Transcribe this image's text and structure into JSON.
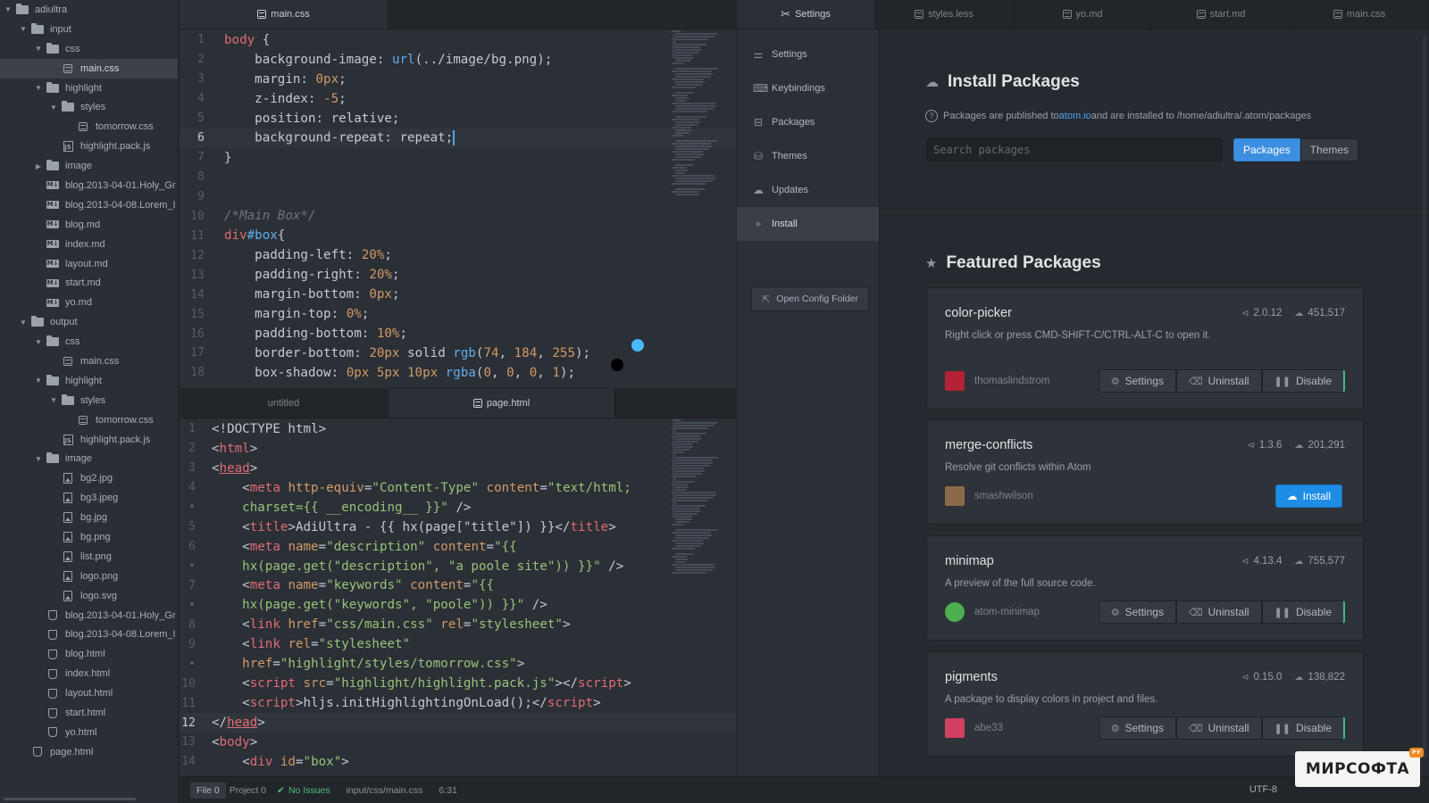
{
  "tree": [
    {
      "label": "adiultra",
      "icon": "folder",
      "depth": 0,
      "arrow": "down"
    },
    {
      "label": "input",
      "icon": "folder",
      "depth": 1,
      "arrow": "down"
    },
    {
      "label": "css",
      "icon": "folder",
      "depth": 2,
      "arrow": "down"
    },
    {
      "label": "main.css",
      "icon": "css",
      "depth": 3,
      "arrow": "none",
      "selected": true
    },
    {
      "label": "highlight",
      "icon": "folder",
      "depth": 2,
      "arrow": "down"
    },
    {
      "label": "styles",
      "icon": "folder",
      "depth": 3,
      "arrow": "down"
    },
    {
      "label": "tomorrow.css",
      "icon": "css",
      "depth": 4,
      "arrow": "none"
    },
    {
      "label": "highlight.pack.js",
      "icon": "js",
      "depth": 3,
      "arrow": "none"
    },
    {
      "label": "image",
      "icon": "folder",
      "depth": 2,
      "arrow": "right"
    },
    {
      "label": "blog.2013-04-01.Holy_Gr",
      "icon": "md",
      "depth": 2,
      "arrow": "none"
    },
    {
      "label": "blog.2013-04-08.Lorem_I",
      "icon": "md",
      "depth": 2,
      "arrow": "none"
    },
    {
      "label": "blog.md",
      "icon": "md",
      "depth": 2,
      "arrow": "none"
    },
    {
      "label": "index.md",
      "icon": "md",
      "depth": 2,
      "arrow": "none"
    },
    {
      "label": "layout.md",
      "icon": "md",
      "depth": 2,
      "arrow": "none"
    },
    {
      "label": "start.md",
      "icon": "md",
      "depth": 2,
      "arrow": "none"
    },
    {
      "label": "yo.md",
      "icon": "md",
      "depth": 2,
      "arrow": "none"
    },
    {
      "label": "output",
      "icon": "folder",
      "depth": 1,
      "arrow": "down"
    },
    {
      "label": "css",
      "icon": "folder",
      "depth": 2,
      "arrow": "down"
    },
    {
      "label": "main.css",
      "icon": "css",
      "depth": 3,
      "arrow": "none"
    },
    {
      "label": "highlight",
      "icon": "folder",
      "depth": 2,
      "arrow": "down"
    },
    {
      "label": "styles",
      "icon": "folder",
      "depth": 3,
      "arrow": "down"
    },
    {
      "label": "tomorrow.css",
      "icon": "css",
      "depth": 4,
      "arrow": "none"
    },
    {
      "label": "highlight.pack.js",
      "icon": "js",
      "depth": 3,
      "arrow": "none"
    },
    {
      "label": "image",
      "icon": "folder",
      "depth": 2,
      "arrow": "down"
    },
    {
      "label": "bg2.jpg",
      "icon": "img",
      "depth": 3,
      "arrow": "none"
    },
    {
      "label": "bg3.jpeg",
      "icon": "img",
      "depth": 3,
      "arrow": "none"
    },
    {
      "label": "bg.jpg",
      "icon": "img",
      "depth": 3,
      "arrow": "none"
    },
    {
      "label": "bg.png",
      "icon": "img",
      "depth": 3,
      "arrow": "none"
    },
    {
      "label": "list.png",
      "icon": "img",
      "depth": 3,
      "arrow": "none"
    },
    {
      "label": "logo.png",
      "icon": "img",
      "depth": 3,
      "arrow": "none"
    },
    {
      "label": "logo.svg",
      "icon": "img",
      "depth": 3,
      "arrow": "none"
    },
    {
      "label": "blog.2013-04-01.Holy_Gr",
      "icon": "html",
      "depth": 2,
      "arrow": "none"
    },
    {
      "label": "blog.2013-04-08.Lorem_I",
      "icon": "html",
      "depth": 2,
      "arrow": "none"
    },
    {
      "label": "blog.html",
      "icon": "html",
      "depth": 2,
      "arrow": "none"
    },
    {
      "label": "index.html",
      "icon": "html",
      "depth": 2,
      "arrow": "none"
    },
    {
      "label": "layout.html",
      "icon": "html",
      "depth": 2,
      "arrow": "none"
    },
    {
      "label": "start.html",
      "icon": "html",
      "depth": 2,
      "arrow": "none"
    },
    {
      "label": "yo.html",
      "icon": "html",
      "depth": 2,
      "arrow": "none"
    },
    {
      "label": "page.html",
      "icon": "html",
      "depth": 1,
      "arrow": "none"
    }
  ],
  "editor_top": {
    "tab": "main.css",
    "cursor_line": 6,
    "lines": [
      [
        [
          "body",
          "t-sel"
        ],
        [
          " {",
          "t-punc"
        ]
      ],
      [
        [
          "    background-image",
          "t-prop"
        ],
        [
          ": ",
          "t-punc"
        ],
        [
          "url",
          "t-fn"
        ],
        [
          "(../image/bg.png);",
          "t-punc"
        ]
      ],
      [
        [
          "    margin",
          "t-prop"
        ],
        [
          ": ",
          "t-punc"
        ],
        [
          "0px",
          "t-num"
        ],
        [
          ";",
          "t-punc"
        ]
      ],
      [
        [
          "    z-index",
          "t-prop"
        ],
        [
          ": ",
          "t-punc"
        ],
        [
          "-5",
          "t-num"
        ],
        [
          ";",
          "t-punc"
        ]
      ],
      [
        [
          "    position",
          "t-prop"
        ],
        [
          ": relative;",
          "t-punc"
        ]
      ],
      [
        [
          "    background-repeat",
          "t-prop"
        ],
        [
          ": repeat;",
          "t-punc"
        ]
      ],
      [
        [
          "}",
          "t-punc"
        ]
      ],
      [],
      [],
      [
        [
          "/*Main Box*/",
          "t-com"
        ]
      ],
      [
        [
          "div",
          "t-sel"
        ],
        [
          "#box",
          "t-id"
        ],
        [
          "{",
          "t-punc"
        ]
      ],
      [
        [
          "    padding-left",
          "t-prop"
        ],
        [
          ": ",
          "t-punc"
        ],
        [
          "20%",
          "t-num"
        ],
        [
          ";",
          "t-punc"
        ]
      ],
      [
        [
          "    padding-right",
          "t-prop"
        ],
        [
          ": ",
          "t-punc"
        ],
        [
          "20%",
          "t-num"
        ],
        [
          ";",
          "t-punc"
        ]
      ],
      [
        [
          "    margin-bottom",
          "t-prop"
        ],
        [
          ": ",
          "t-punc"
        ],
        [
          "0px",
          "t-num"
        ],
        [
          ";",
          "t-punc"
        ]
      ],
      [
        [
          "    margin-top",
          "t-prop"
        ],
        [
          ": ",
          "t-punc"
        ],
        [
          "0%",
          "t-num"
        ],
        [
          ";",
          "t-punc"
        ]
      ],
      [
        [
          "    padding-bottom",
          "t-prop"
        ],
        [
          ": ",
          "t-punc"
        ],
        [
          "10%",
          "t-num"
        ],
        [
          ";",
          "t-punc"
        ]
      ],
      [
        [
          "    border-bottom",
          "t-prop"
        ],
        [
          ": ",
          "t-punc"
        ],
        [
          "20px",
          "t-num"
        ],
        [
          " solid ",
          "t-punc"
        ],
        [
          "rgb",
          "t-fn"
        ],
        [
          "(",
          "t-punc"
        ],
        [
          "74",
          "t-num"
        ],
        [
          ", ",
          "t-punc"
        ],
        [
          "184",
          "t-num"
        ],
        [
          ", ",
          "t-punc"
        ],
        [
          "255",
          "t-num"
        ],
        [
          ");",
          "t-punc"
        ]
      ],
      [
        [
          "    box-shadow",
          "t-prop"
        ],
        [
          ": ",
          "t-punc"
        ],
        [
          "0px 5px 10px ",
          "t-num"
        ],
        [
          "rgba",
          "t-fn"
        ],
        [
          "(",
          "t-punc"
        ],
        [
          "0",
          "t-num"
        ],
        [
          ", ",
          "t-punc"
        ],
        [
          "0",
          "t-num"
        ],
        [
          ", ",
          "t-punc"
        ],
        [
          "0",
          "t-num"
        ],
        [
          ", ",
          "t-punc"
        ],
        [
          "1",
          "t-num"
        ],
        [
          ");",
          "t-punc"
        ]
      ]
    ]
  },
  "editor_bottom": {
    "tabs": [
      "untitled",
      "page.html"
    ],
    "cursor_line": 12,
    "lines": [
      {
        "n": "1",
        "s": [
          [
            "<!DOCTYPE html>",
            "t-punc"
          ]
        ]
      },
      {
        "n": "2",
        "s": [
          [
            "<",
            "t-punc"
          ],
          [
            "html",
            "t-tag"
          ],
          [
            ">",
            "t-punc"
          ]
        ]
      },
      {
        "n": "3",
        "s": [
          [
            "<",
            "t-punc"
          ],
          [
            "head",
            "t-tag u"
          ],
          [
            ">",
            "t-punc"
          ]
        ]
      },
      {
        "n": "4",
        "s": [
          [
            "    <",
            "t-punc"
          ],
          [
            "meta ",
            "t-tag"
          ],
          [
            "http-equiv",
            "t-attr"
          ],
          [
            "=",
            "t-punc"
          ],
          [
            "\"Content-Type\" ",
            "t-str"
          ],
          [
            "content",
            "t-attr"
          ],
          [
            "=",
            "t-punc"
          ],
          [
            "\"text/html;",
            "t-str"
          ]
        ]
      },
      {
        "n": "•",
        "s": [
          [
            "    charset={{ __encoding__ }}\"",
            "t-str"
          ],
          [
            " />",
            "t-punc"
          ]
        ]
      },
      {
        "n": "5",
        "s": [
          [
            "    <",
            "t-punc"
          ],
          [
            "title",
            "t-tag"
          ],
          [
            ">AdiUltra - {{ hx(page[\"title\"]) }}</",
            "t-punc"
          ],
          [
            "title",
            "t-tag"
          ],
          [
            ">",
            "t-punc"
          ]
        ]
      },
      {
        "n": "6",
        "s": [
          [
            "    <",
            "t-punc"
          ],
          [
            "meta ",
            "t-tag"
          ],
          [
            "name",
            "t-attr"
          ],
          [
            "=",
            "t-punc"
          ],
          [
            "\"description\" ",
            "t-str"
          ],
          [
            "content",
            "t-attr"
          ],
          [
            "=",
            "t-punc"
          ],
          [
            "\"{{",
            "t-str"
          ]
        ]
      },
      {
        "n": "•",
        "s": [
          [
            "    hx(page.get(\"description\", \"a poole site\")) }}\"",
            "t-str"
          ],
          [
            " />",
            "t-punc"
          ]
        ]
      },
      {
        "n": "7",
        "s": [
          [
            "    <",
            "t-punc"
          ],
          [
            "meta ",
            "t-tag"
          ],
          [
            "name",
            "t-attr"
          ],
          [
            "=",
            "t-punc"
          ],
          [
            "\"keywords\" ",
            "t-str"
          ],
          [
            "content",
            "t-attr"
          ],
          [
            "=",
            "t-punc"
          ],
          [
            "\"{{",
            "t-str"
          ]
        ]
      },
      {
        "n": "•",
        "s": [
          [
            "    hx(page.get(\"keywords\", \"poole\")) }}\"",
            "t-str"
          ],
          [
            " />",
            "t-punc"
          ]
        ]
      },
      {
        "n": "8",
        "s": [
          [
            "    <",
            "t-punc"
          ],
          [
            "link ",
            "t-tag"
          ],
          [
            "href",
            "t-attr"
          ],
          [
            "=",
            "t-punc"
          ],
          [
            "\"css/main.css\" ",
            "t-str"
          ],
          [
            "rel",
            "t-attr"
          ],
          [
            "=",
            "t-punc"
          ],
          [
            "\"stylesheet\"",
            "t-str"
          ],
          [
            ">",
            "t-punc"
          ]
        ]
      },
      {
        "n": "9",
        "s": [
          [
            "    <",
            "t-punc"
          ],
          [
            "link ",
            "t-tag"
          ],
          [
            "rel",
            "t-attr"
          ],
          [
            "=",
            "t-punc"
          ],
          [
            "\"stylesheet\"",
            "t-str"
          ]
        ]
      },
      {
        "n": "•",
        "s": [
          [
            "    ",
            "t-punc"
          ],
          [
            "href",
            "t-attr"
          ],
          [
            "=",
            "t-punc"
          ],
          [
            "\"highlight/styles/tomorrow.css\"",
            "t-str"
          ],
          [
            ">",
            "t-punc"
          ]
        ]
      },
      {
        "n": "10",
        "s": [
          [
            "    <",
            "t-punc"
          ],
          [
            "script ",
            "t-tag"
          ],
          [
            "src",
            "t-attr"
          ],
          [
            "=",
            "t-punc"
          ],
          [
            "\"highlight/highlight.pack.js\"",
            "t-str"
          ],
          [
            "></",
            "t-punc"
          ],
          [
            "script",
            "t-tag"
          ],
          [
            ">",
            "t-punc"
          ]
        ]
      },
      {
        "n": "11",
        "s": [
          [
            "    <",
            "t-punc"
          ],
          [
            "script",
            "t-tag"
          ],
          [
            ">hljs.initHighlightingOnLoad();</",
            "t-punc"
          ],
          [
            "script",
            "t-tag"
          ],
          [
            ">",
            "t-punc"
          ]
        ]
      },
      {
        "n": "12",
        "s": [
          [
            "</",
            "t-punc"
          ],
          [
            "head",
            "t-tag u"
          ],
          [
            ">",
            "t-punc"
          ]
        ]
      },
      {
        "n": "13",
        "s": [
          [
            "<",
            "t-punc"
          ],
          [
            "body",
            "t-tag"
          ],
          [
            ">",
            "t-punc"
          ]
        ]
      },
      {
        "n": "14",
        "s": [
          [
            "    <",
            "t-punc"
          ],
          [
            "div ",
            "t-tag"
          ],
          [
            "id",
            "t-attr"
          ],
          [
            "=",
            "t-punc"
          ],
          [
            "\"box\"",
            "t-str"
          ],
          [
            ">",
            "t-punc"
          ]
        ]
      }
    ]
  },
  "settings": {
    "tabs": [
      {
        "label": "Settings",
        "active": true
      },
      {
        "label": "styles.less",
        "active": false
      },
      {
        "label": "yo.md",
        "active": false
      },
      {
        "label": "start.md",
        "active": false
      },
      {
        "label": "main.css",
        "active": false
      }
    ],
    "nav": [
      {
        "label": "Settings",
        "icon": "sliders-icon"
      },
      {
        "label": "Keybindings",
        "icon": "keyboard-icon"
      },
      {
        "label": "Packages",
        "icon": "package-icon"
      },
      {
        "label": "Themes",
        "icon": "paintcan-icon"
      },
      {
        "label": "Updates",
        "icon": "cloud-icon"
      },
      {
        "label": "Install",
        "icon": "plus-icon",
        "active": true
      }
    ],
    "config_button": "Open Config Folder",
    "install": {
      "title": "Install Packages",
      "desc_prefix": "Packages are published to ",
      "desc_link": "atom.io",
      "desc_suffix": " and are installed to /home/adiultra/.atom/packages",
      "search_placeholder": "Search packages",
      "toggle_packages": "Packages",
      "toggle_themes": "Themes"
    },
    "featured_title": "Featured Packages",
    "packages": [
      {
        "name": "color-picker",
        "version": "2.0.12",
        "downloads": "451,517",
        "desc": "Right click or press CMD-SHIFT-C/CTRL-ALT-C to open it.",
        "owner": "thomaslindstrom",
        "installed": true,
        "avatar_color": "#b22234"
      },
      {
        "name": "merge-conflicts",
        "version": "1.3.6",
        "downloads": "201,291",
        "desc": "Resolve git conflicts within Atom",
        "owner": "smashwilson",
        "installed": false,
        "avatar_color": "#8a6a4a"
      },
      {
        "name": "minimap",
        "version": "4.13.4",
        "downloads": "755,577",
        "desc": "A preview of the full source code.",
        "owner": "atom-minimap",
        "installed": true,
        "avatar_color": "#4caf50"
      },
      {
        "name": "pigments",
        "version": "0.15.0",
        "downloads": "138,822",
        "desc": "A package to display colors in project and files.",
        "owner": "abe33",
        "installed": true,
        "avatar_color": "#d04060"
      }
    ],
    "buttons": {
      "settings": "Settings",
      "uninstall": "Uninstall",
      "disable": "Disable",
      "install": "Install"
    }
  },
  "status": {
    "file": "File 0",
    "project": "Project 0",
    "issues": "No Issues",
    "path": "input/css/main.css",
    "position": "6:31",
    "encoding": "UTF-8"
  },
  "watermark": "МИРСОФТА"
}
